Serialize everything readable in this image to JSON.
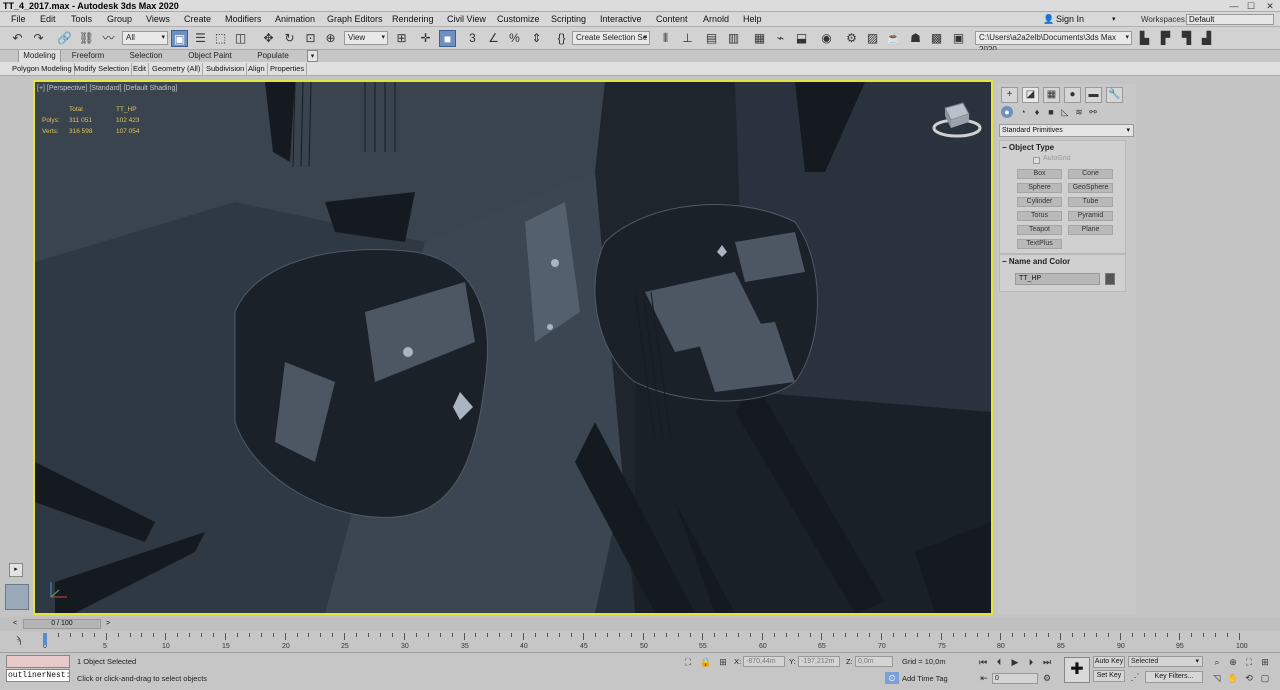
{
  "window": {
    "title": "TT_4_2017.max - Autodesk 3ds Max 2020",
    "minimize": "—",
    "maximize": "☐",
    "close": "✕"
  },
  "menu": [
    "File",
    "Edit",
    "Tools",
    "Group",
    "Views",
    "Create",
    "Modifiers",
    "Animation",
    "Graph Editors",
    "Rendering",
    "Civil View",
    "Customize",
    "Scripting",
    "Interactive",
    "Content",
    "Arnold",
    "Help"
  ],
  "account": {
    "signin": "Sign In",
    "workspaces_label": "Workspaces:",
    "workspace": "Default"
  },
  "toolbar": {
    "filter": "All",
    "refcoord": "View",
    "selection_set": "Create Selection Se",
    "project_path": "C:\\Users\\a2a2elb\\Documents\\3ds Max 2020"
  },
  "ribbon": {
    "tabs": [
      "Modeling",
      "Freeform",
      "Selection",
      "Object Paint",
      "Populate"
    ],
    "subitems": [
      "Polygon Modeling",
      "Modify Selection",
      "Edit",
      "Geometry (All)",
      "Subdivision",
      "Align",
      "Properties"
    ]
  },
  "viewport": {
    "label": "[+] [Perspective] [Standard] [Default Shading]",
    "stats": {
      "header_total": "Total",
      "header_obj": "TT_HP",
      "polys_label": "Polys:",
      "polys_total": "311 051",
      "polys_obj": "102 423",
      "verts_label": "Verts:",
      "verts_total": "316 598",
      "verts_obj": "107 054"
    }
  },
  "command_panel": {
    "category": "Standard Primitives",
    "object_type_title": "Object Type",
    "autogrid": "AutoGrid",
    "buttons": [
      "Box",
      "Cone",
      "Sphere",
      "GeoSphere",
      "Cylinder",
      "Tube",
      "Torus",
      "Pyramid",
      "Teapot",
      "Plane",
      "TextPlus"
    ],
    "name_color_title": "Name and Color",
    "object_name": "TT_HP",
    "object_color": "#555555"
  },
  "timeline": {
    "frame": "0 / 100",
    "ticks": [
      "0",
      "5",
      "10",
      "15",
      "20",
      "25",
      "30",
      "35",
      "40",
      "45",
      "50",
      "55",
      "60",
      "65",
      "70",
      "75",
      "80",
      "85",
      "90",
      "95",
      "100"
    ]
  },
  "status": {
    "maxscript": "outlinerNest:",
    "selected": "1 Object Selected",
    "prompt": "Click or click-and-drag to select objects",
    "x_label": "X:",
    "x_val": "-870,44m",
    "y_label": "Y:",
    "y_val": "-197,212m",
    "z_label": "Z:",
    "z_val": "0,0m",
    "grid": "Grid = 10,0m",
    "add_time_tag": "Add Time Tag",
    "autokey": "Auto Key",
    "setkey": "Set Key",
    "key_mode": "Selected",
    "key_filters": "Key Filters...",
    "current_frame": "0"
  }
}
